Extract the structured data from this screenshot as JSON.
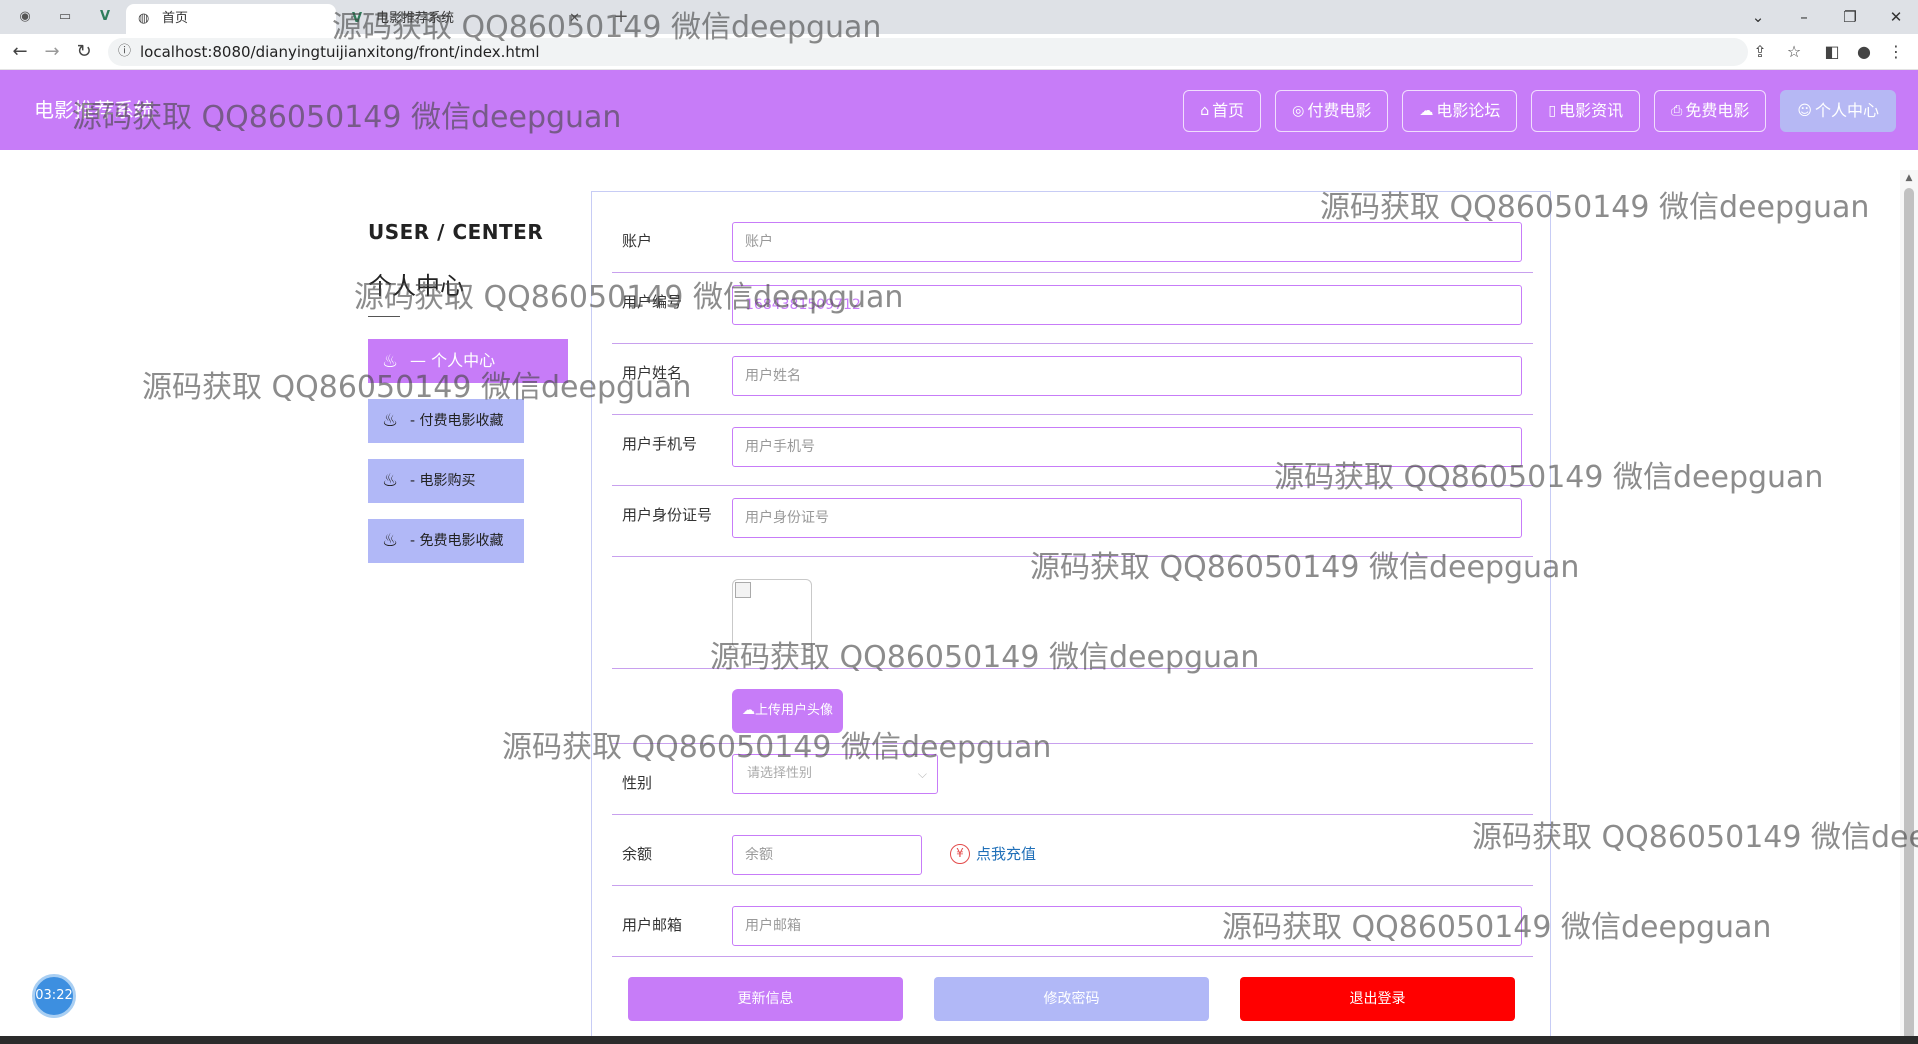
{
  "browser": {
    "tabs": [
      {
        "title": "首页",
        "active": true
      },
      {
        "title": "电影推荐系统",
        "active": false
      }
    ],
    "new_tab_symbol": "+",
    "url": "localhost:8080/dianyingtuijianxitong/front/index.html"
  },
  "site": {
    "brand": "电影推荐系统",
    "nav": [
      {
        "label": "首页",
        "icon": "home-icon"
      },
      {
        "label": "付费电影",
        "icon": "coin-icon"
      },
      {
        "label": "电影论坛",
        "icon": "cloud-icon"
      },
      {
        "label": "电影资讯",
        "icon": "document-icon"
      },
      {
        "label": "免费电影",
        "icon": "print-icon"
      },
      {
        "label": "个人中心",
        "icon": "user-icon",
        "active": true
      }
    ]
  },
  "sidebar": {
    "title": "USER / CENTER",
    "subtitle": "个人中心",
    "items": [
      {
        "label": "—  个人中心",
        "active": true
      },
      {
        "label": "-  付费电影收藏"
      },
      {
        "label": "-  电影购买"
      },
      {
        "label": "-  免费电影收藏"
      }
    ]
  },
  "form": {
    "account": {
      "label": "账户",
      "placeholder": "账户"
    },
    "user_no": {
      "label": "用户编号",
      "value": "1684381509712"
    },
    "user_name": {
      "label": "用户姓名",
      "placeholder": "用户姓名"
    },
    "phone": {
      "label": "用户手机号",
      "placeholder": "用户手机号"
    },
    "id_card": {
      "label": "用户身份证号",
      "placeholder": "用户身份证号"
    },
    "avatar_upload": "上传用户头像",
    "gender": {
      "label": "性别",
      "placeholder": "请选择性别"
    },
    "balance": {
      "label": "余额",
      "placeholder": "余额",
      "recharge_link": "点我充值",
      "yen_symbol": "¥"
    },
    "email": {
      "label": "用户邮箱",
      "placeholder": "用户邮箱"
    }
  },
  "buttons": {
    "update": "更新信息",
    "change_password": "修改密码",
    "logout": "退出登录"
  },
  "timer": "03:22",
  "watermark": "源码获取 QQ86050149 微信deepguan",
  "colors": {
    "primary": "#c77cf8",
    "secondary": "#b1b8f7",
    "danger": "#ff0000",
    "link": "#1f6fb8"
  }
}
